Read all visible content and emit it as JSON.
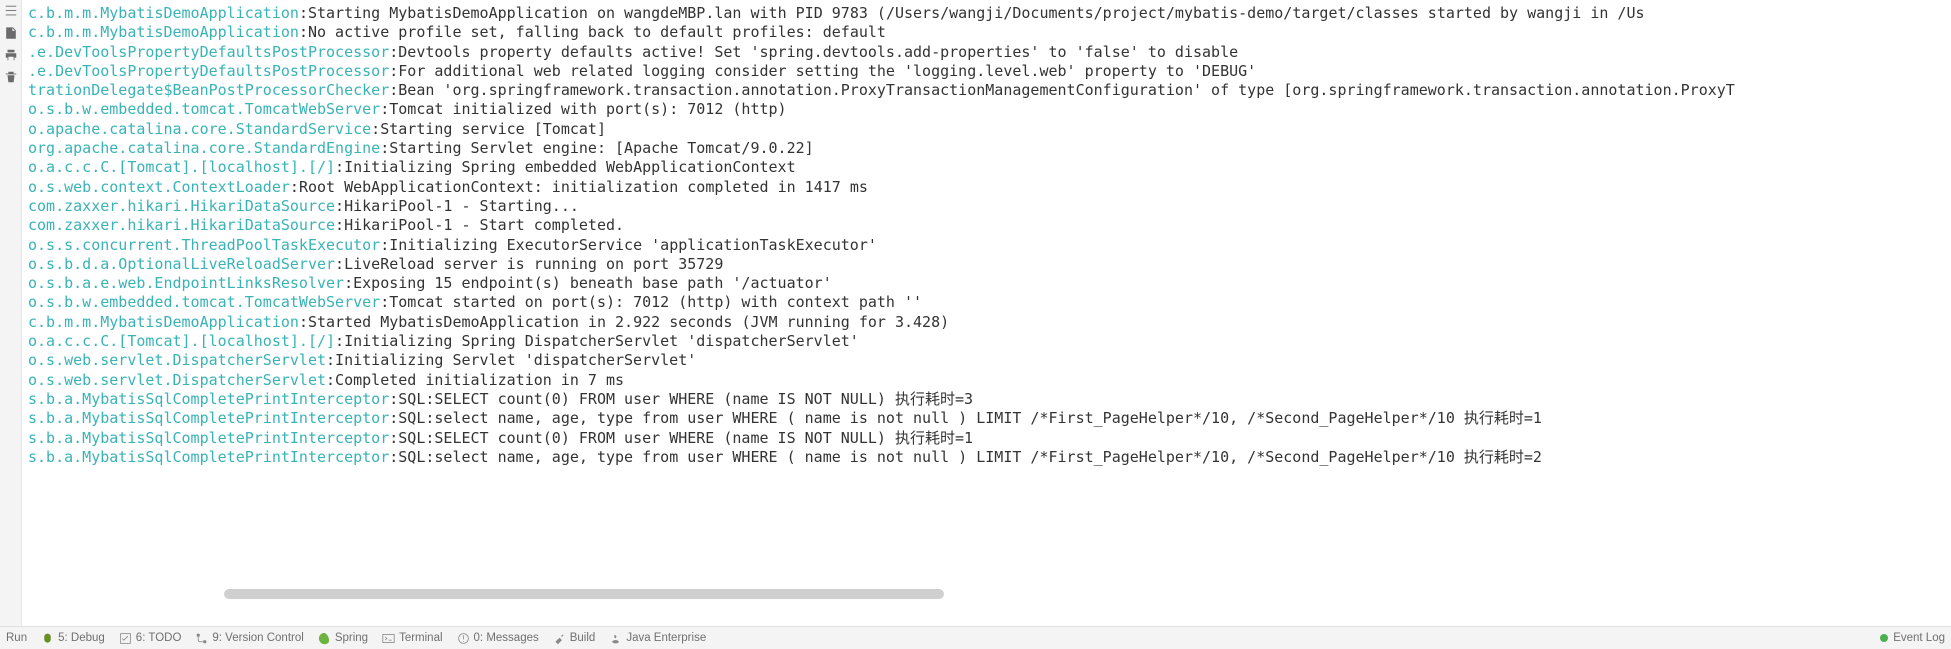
{
  "layout": {
    "logger_col_width_chars": 41
  },
  "console_lines": [
    {
      "logger": "c.b.m.m.MybatisDemoApplication",
      "message": "Starting MybatisDemoApplication on wangdeMBP.lan with PID 9783 (/Users/wangji/Documents/project/mybatis-demo/target/classes started by wangji in /Us"
    },
    {
      "logger": "c.b.m.m.MybatisDemoApplication",
      "message": "No active profile set, falling back to default profiles: default"
    },
    {
      "logger": ".e.DevToolsPropertyDefaultsPostProcessor",
      "message": "Devtools property defaults active! Set 'spring.devtools.add-properties' to 'false' to disable"
    },
    {
      "logger": ".e.DevToolsPropertyDefaultsPostProcessor",
      "message": "For additional web related logging consider setting the 'logging.level.web' property to 'DEBUG'"
    },
    {
      "logger": "trationDelegate$BeanPostProcessorChecker",
      "message": "Bean 'org.springframework.transaction.annotation.ProxyTransactionManagementConfiguration' of type [org.springframework.transaction.annotation.ProxyT"
    },
    {
      "logger": "o.s.b.w.embedded.tomcat.TomcatWebServer",
      "message": "Tomcat initialized with port(s): 7012 (http)"
    },
    {
      "logger": "o.apache.catalina.core.StandardService",
      "message": "Starting service [Tomcat]"
    },
    {
      "logger": "org.apache.catalina.core.StandardEngine",
      "message": "Starting Servlet engine: [Apache Tomcat/9.0.22]"
    },
    {
      "logger": "o.a.c.c.C.[Tomcat].[localhost].[/]",
      "message": "Initializing Spring embedded WebApplicationContext"
    },
    {
      "logger": "o.s.web.context.ContextLoader",
      "message": "Root WebApplicationContext: initialization completed in 1417 ms"
    },
    {
      "logger": "com.zaxxer.hikari.HikariDataSource",
      "message": "HikariPool-1 - Starting..."
    },
    {
      "logger": "com.zaxxer.hikari.HikariDataSource",
      "message": "HikariPool-1 - Start completed."
    },
    {
      "logger": "o.s.s.concurrent.ThreadPoolTaskExecutor",
      "message": "Initializing ExecutorService 'applicationTaskExecutor'"
    },
    {
      "logger": "o.s.b.d.a.OptionalLiveReloadServer",
      "message": "LiveReload server is running on port 35729"
    },
    {
      "logger": "o.s.b.a.e.web.EndpointLinksResolver",
      "message": "Exposing 15 endpoint(s) beneath base path '/actuator'"
    },
    {
      "logger": "o.s.b.w.embedded.tomcat.TomcatWebServer",
      "message": "Tomcat started on port(s): 7012 (http) with context path ''"
    },
    {
      "logger": "c.b.m.m.MybatisDemoApplication",
      "message": "Started MybatisDemoApplication in 2.922 seconds (JVM running for 3.428)"
    },
    {
      "logger": "o.a.c.c.C.[Tomcat].[localhost].[/]",
      "message": "Initializing Spring DispatcherServlet 'dispatcherServlet'"
    },
    {
      "logger": "o.s.web.servlet.DispatcherServlet",
      "message": "Initializing Servlet 'dispatcherServlet'"
    },
    {
      "logger": "o.s.web.servlet.DispatcherServlet",
      "message": "Completed initialization in 7 ms"
    },
    {
      "logger": "s.b.a.MybatisSqlCompletePrintInterceptor",
      "message": "SQL:SELECT count(0) FROM user WHERE (name IS NOT NULL)    执行耗时=3"
    },
    {
      "logger": "s.b.a.MybatisSqlCompletePrintInterceptor",
      "message": "SQL:select name, age, type from user WHERE ( name is not null ) LIMIT /*First_PageHelper*/10, /*Second_PageHelper*/10     执行耗时=1"
    },
    {
      "logger": "s.b.a.MybatisSqlCompletePrintInterceptor",
      "message": "SQL:SELECT count(0) FROM user WHERE (name IS NOT NULL)    执行耗时=1"
    },
    {
      "logger": "s.b.a.MybatisSqlCompletePrintInterceptor",
      "message": "SQL:select name, age, type from user WHERE ( name is not null ) LIMIT /*First_PageHelper*/10, /*Second_PageHelper*/10     执行耗时=2"
    }
  ],
  "footer": {
    "tabs": [
      {
        "label": "Run"
      },
      {
        "label": "5: Debug"
      },
      {
        "label": "6: TODO"
      },
      {
        "label": "9: Version Control"
      },
      {
        "label": "Spring"
      },
      {
        "label": "Terminal"
      },
      {
        "label": "0: Messages"
      },
      {
        "label": "Build"
      },
      {
        "label": "Java Enterprise"
      }
    ],
    "event_log_label": "Event Log"
  }
}
